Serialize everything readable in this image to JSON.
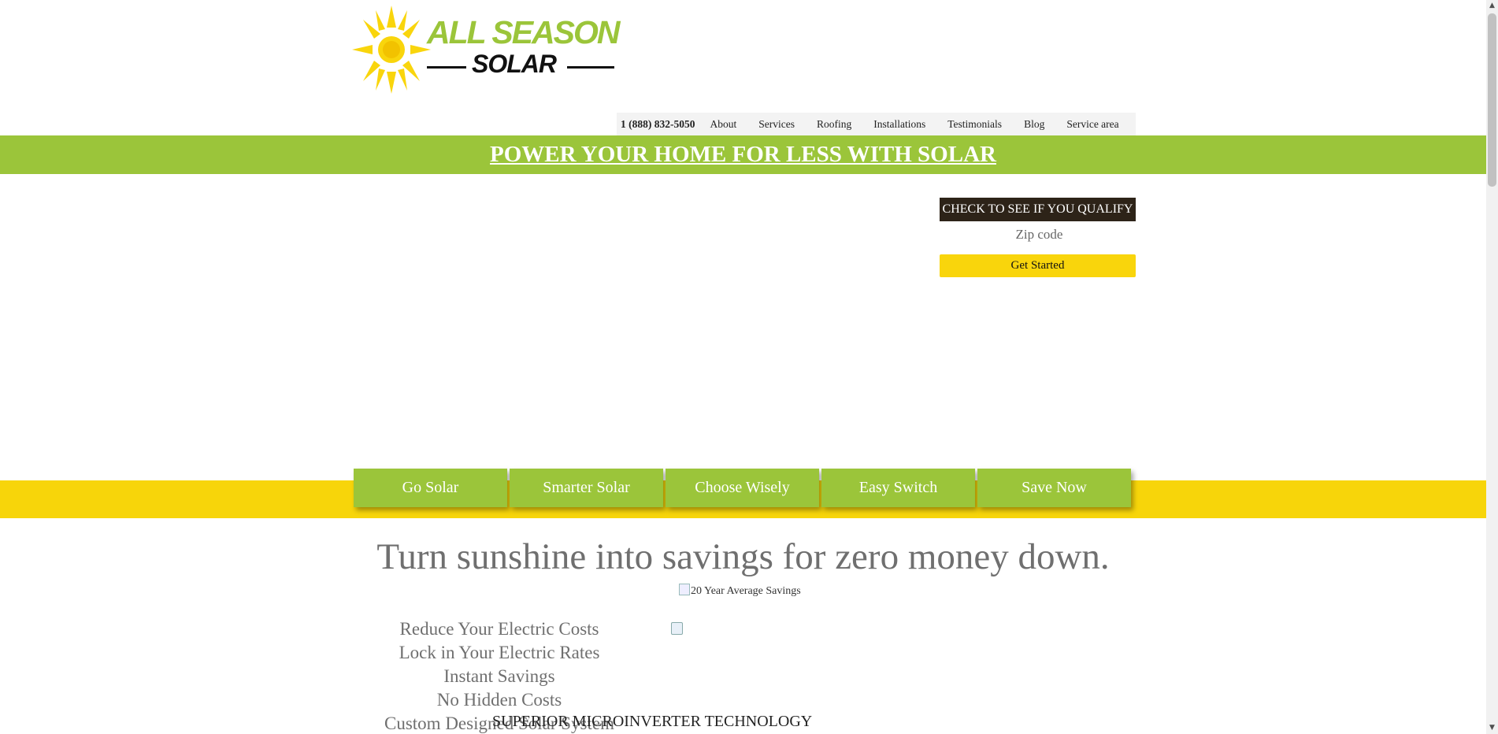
{
  "logo": {
    "line1": "ALL SEASON",
    "line2": "SOLAR"
  },
  "nav": {
    "phone": "1 (888) 832-5050",
    "items": [
      "About",
      "Services",
      "Roofing",
      "Installations",
      "Testimonials",
      "Blog",
      "Service area"
    ]
  },
  "banner": {
    "text": "POWER YOUR HOME FOR LESS WITH SOLAR"
  },
  "form": {
    "title": "CHECK TO SEE IF YOU QUALIFY",
    "zip_placeholder": "Zip code",
    "button": "Get Started"
  },
  "tabs": [
    "Go Solar",
    "Smarter Solar",
    "Choose Wisely",
    "Easy Switch",
    "Save Now"
  ],
  "main": {
    "headline": "Turn sunshine into savings for zero money down.",
    "avg_image_alt": "20 Year Average Savings",
    "benefits": [
      "Reduce Your Electric Costs",
      "Lock in Your Electric Rates",
      "Instant Savings",
      "No Hidden Costs",
      "Custom Designed Solar System"
    ],
    "micro_heading": "SUPERIOR MICROINVERTER TECHNOLOGY"
  },
  "colors": {
    "brand_green": "#9bc53a",
    "brand_yellow": "#f7d50a",
    "dark": "#2d2318"
  }
}
